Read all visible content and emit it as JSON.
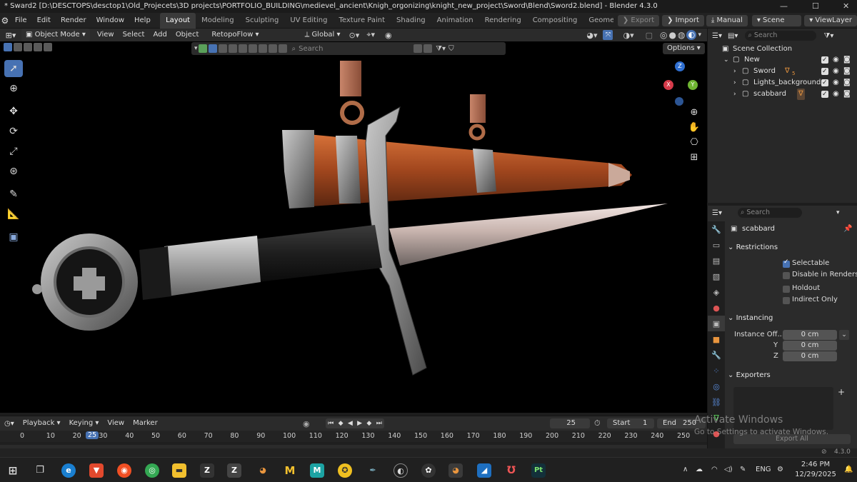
{
  "window": {
    "title": "* Sward2 [D:\\DESCTOPS\\desctop1\\Old_Projecets\\3D projects\\PORTFOLIO_BUILDING\\medievel_ancient\\Knigh_orgonizing\\knight_new_project\\Sword\\Blend\\Sword2.blend] - Blender 4.3.0",
    "min_icon": "—",
    "max_icon": "☐",
    "close_icon": "✕"
  },
  "menubar": {
    "items": [
      "File",
      "Edit",
      "Render",
      "Window",
      "Help"
    ],
    "workspaces": [
      "Layout",
      "Modeling",
      "Sculpting",
      "UV Editing",
      "Texture Paint",
      "Shading",
      "Animation",
      "Rendering",
      "Compositing",
      "Geometry N"
    ],
    "export_label": "Export",
    "import_label": "Import",
    "manual_label": "Manual",
    "scene_label": "Scene",
    "viewlayer_label": "ViewLayer"
  },
  "viewport_header": {
    "mode": "Object Mode",
    "menus": [
      "View",
      "Select",
      "Add",
      "Object",
      "RetopoFlow"
    ],
    "transform_orientation": "Global",
    "options_label": "Options",
    "search_placeholder": "Search"
  },
  "outliner": {
    "search_placeholder": "Search",
    "root": "Scene Collection",
    "collection": "New",
    "items": [
      "Sword",
      "Lights_backgrounds",
      "scabbard"
    ],
    "sword_badge": "5"
  },
  "properties": {
    "search_placeholder": "Search",
    "object_name": "scabbard",
    "restrictions": {
      "title": "Restrictions",
      "selectable": "Selectable",
      "disable_in_renders": "Disable in Renders",
      "holdout": "Holdout",
      "indirect_only": "Indirect Only"
    },
    "instancing": {
      "title": "Instancing",
      "label": "Instance Off...",
      "x": "0 cm",
      "y_label": "Y",
      "y": "0 cm",
      "z_label": "Z",
      "z": "0 cm"
    },
    "exporters": {
      "title": "Exporters",
      "export_all": "Export All"
    }
  },
  "timeline": {
    "menus": [
      "Playback",
      "Keying",
      "View",
      "Marker"
    ],
    "current_frame": "25",
    "start_label": "Start",
    "start": "1",
    "end_label": "End",
    "end": "250",
    "ticks": [
      "0",
      "10",
      "20",
      "25",
      "30",
      "40",
      "50",
      "60",
      "70",
      "80",
      "90",
      "100",
      "110",
      "120",
      "130",
      "140",
      "150",
      "160",
      "170",
      "180",
      "190",
      "200",
      "210",
      "220",
      "230",
      "240",
      "250"
    ]
  },
  "watermark": {
    "line1": "Activate Windows",
    "line2": "Go to Settings to activate Windows."
  },
  "statusbar": {
    "version": "4.3.0"
  },
  "taskbar": {
    "language": "ENG",
    "time": "2:46 PM",
    "date": "12/29/2025",
    "app_m_label": "M",
    "app_pt_label": "Pt"
  },
  "gizmo": {
    "x": "X",
    "y": "Y",
    "z": "Z"
  },
  "colors": {
    "accent": "#4772b3",
    "viewport_bg": "#000000",
    "panel_bg": "#2b2b2b"
  }
}
